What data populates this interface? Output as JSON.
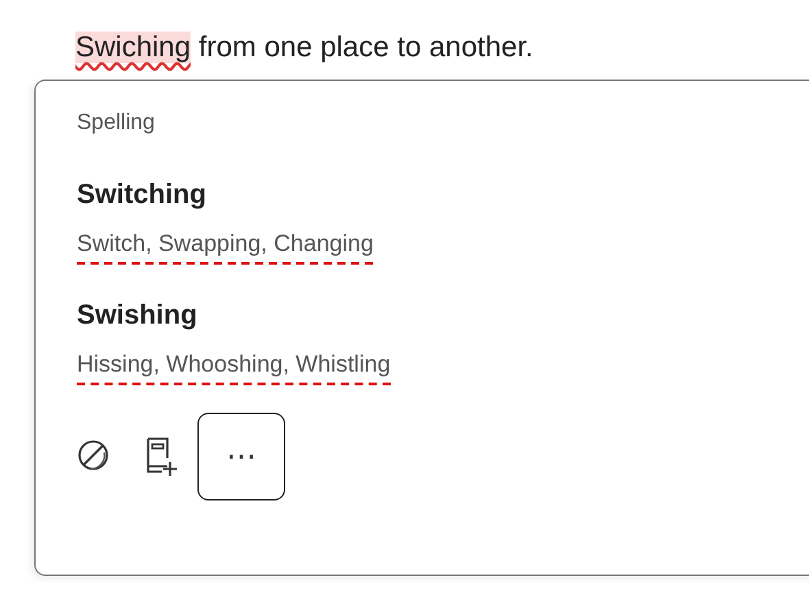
{
  "document": {
    "misspelled_word": "Swiching",
    "rest": " from one place to another."
  },
  "popup": {
    "heading": "Spelling",
    "suggestions": [
      {
        "word": "Switching",
        "synonyms": "Switch, Swapping, Changing"
      },
      {
        "word": "Swishing",
        "synonyms": "Hissing, Whooshing, Whistling"
      }
    ],
    "more_button": "⋯"
  }
}
